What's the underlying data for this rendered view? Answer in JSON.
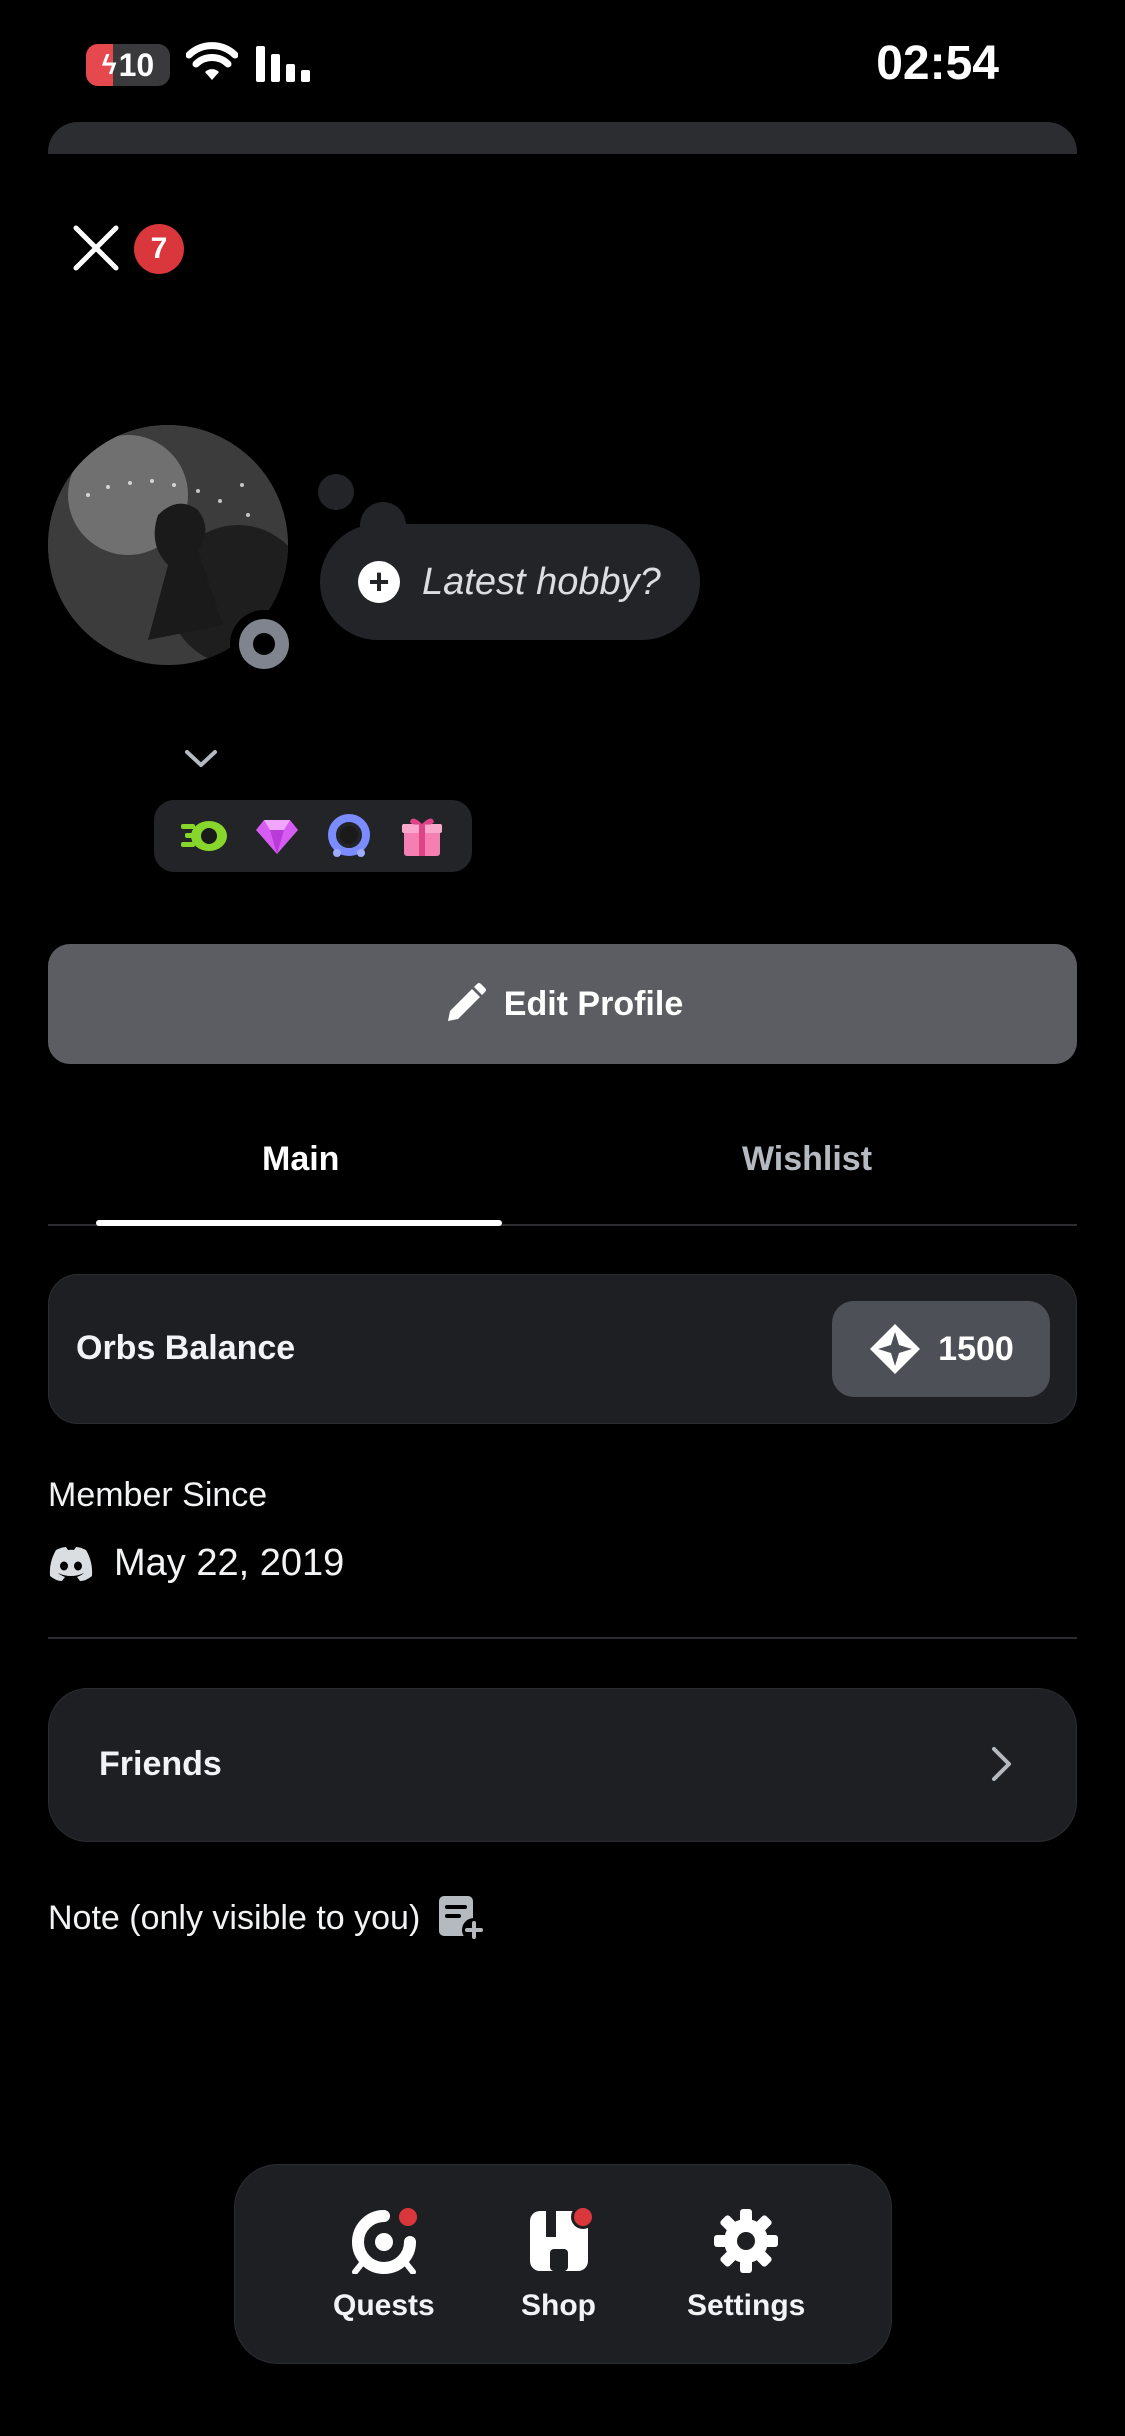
{
  "status_bar": {
    "battery": "10",
    "time": "02:54"
  },
  "header": {
    "close_badge": "7"
  },
  "profile": {
    "hobby_prompt": "Latest hobby?",
    "badges": [
      "nitro-badge-icon",
      "gem-badge-icon",
      "laurel-badge-icon",
      "gift-badge-icon"
    ]
  },
  "actions": {
    "edit_profile": "Edit Profile"
  },
  "tabs": [
    {
      "label": "Main",
      "active": true
    },
    {
      "label": "Wishlist",
      "active": false
    }
  ],
  "orbs": {
    "label": "Orbs Balance",
    "value": "1500"
  },
  "member": {
    "label": "Member Since",
    "date": "May 22, 2019"
  },
  "friends": {
    "label": "Friends"
  },
  "note": {
    "label": "Note (only visible to you)"
  },
  "tabbar": [
    {
      "label": "Quests",
      "icon": "quests-icon",
      "notification": true
    },
    {
      "label": "Shop",
      "icon": "shop-icon",
      "notification": true
    },
    {
      "label": "Settings",
      "icon": "gear-icon",
      "notification": false
    }
  ],
  "colors": {
    "background": "#000000",
    "card": "#1e1f22",
    "button": "#5c5d62",
    "notification": "#da373c"
  }
}
